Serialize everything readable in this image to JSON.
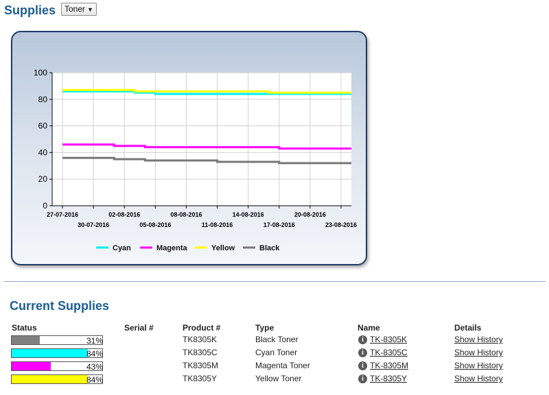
{
  "header": {
    "title": "Supplies",
    "filter_value": "Toner",
    "caret": "▼"
  },
  "chart_data": {
    "type": "line",
    "title": "",
    "xlabel": "",
    "ylabel": "",
    "ylim": [
      0,
      100
    ],
    "yticks": [
      0,
      20,
      40,
      60,
      80,
      100
    ],
    "xticks_top": [
      "27-07-2016",
      "02-08-2016",
      "08-08-2016",
      "14-08-2016",
      "20-08-2016"
    ],
    "xticks_bottom": [
      "30-07-2016",
      "05-08-2016",
      "11-08-2016",
      "17-08-2016",
      "23-08-2016"
    ],
    "grid": true,
    "legend_position": "bottom",
    "series": [
      {
        "name": "Cyan",
        "color": "#00f0f0",
        "points": [
          [
            "27-07-2016",
            86
          ],
          [
            "03-08-2016",
            86
          ],
          [
            "03-08-2016",
            85
          ],
          [
            "05-08-2016",
            85
          ],
          [
            "05-08-2016",
            84
          ],
          [
            "24-08-2016",
            84
          ]
        ]
      },
      {
        "name": "Magenta",
        "color": "#ff00ff",
        "points": [
          [
            "27-07-2016",
            46
          ],
          [
            "01-08-2016",
            46
          ],
          [
            "01-08-2016",
            45
          ],
          [
            "04-08-2016",
            45
          ],
          [
            "04-08-2016",
            44
          ],
          [
            "17-08-2016",
            44
          ],
          [
            "17-08-2016",
            43
          ],
          [
            "24-08-2016",
            43
          ]
        ]
      },
      {
        "name": "Yellow",
        "color": "#ffff00",
        "points": [
          [
            "27-07-2016",
            87
          ],
          [
            "03-08-2016",
            87
          ],
          [
            "03-08-2016",
            86
          ],
          [
            "16-08-2016",
            86
          ],
          [
            "16-08-2016",
            85
          ],
          [
            "24-08-2016",
            85
          ]
        ]
      },
      {
        "name": "Black",
        "color": "#777777",
        "points": [
          [
            "27-07-2016",
            36
          ],
          [
            "01-08-2016",
            36
          ],
          [
            "01-08-2016",
            35
          ],
          [
            "04-08-2016",
            35
          ],
          [
            "04-08-2016",
            34
          ],
          [
            "11-08-2016",
            34
          ],
          [
            "11-08-2016",
            33
          ],
          [
            "17-08-2016",
            33
          ],
          [
            "17-08-2016",
            32
          ],
          [
            "24-08-2016",
            32
          ]
        ]
      }
    ]
  },
  "current": {
    "title": "Current Supplies",
    "headers": {
      "status": "Status",
      "serial": "Serial #",
      "product": "Product #",
      "type": "Type",
      "name": "Name",
      "details": "Details"
    },
    "rows": [
      {
        "level": 31,
        "pct": "31%",
        "color": "#808080",
        "serial": "",
        "product": "TK8305K",
        "type": "Black Toner",
        "name": "TK-8305K",
        "details": "Show History",
        "info": "i"
      },
      {
        "level": 84,
        "pct": "84%",
        "color": "#00ffff",
        "serial": "",
        "product": "TK8305C",
        "type": "Cyan Toner",
        "name": "TK-8305C",
        "details": "Show History",
        "info": "i"
      },
      {
        "level": 43,
        "pct": "43%",
        "color": "#ff00ff",
        "serial": "",
        "product": "TK8305M",
        "type": "Magenta Toner",
        "name": "TK-8305M",
        "details": "Show History",
        "info": "i"
      },
      {
        "level": 84,
        "pct": "84%",
        "color": "#ffff00",
        "serial": "",
        "product": "TK8305Y",
        "type": "Yellow Toner",
        "name": "TK-8305Y",
        "details": "Show History",
        "info": "i"
      }
    ]
  }
}
